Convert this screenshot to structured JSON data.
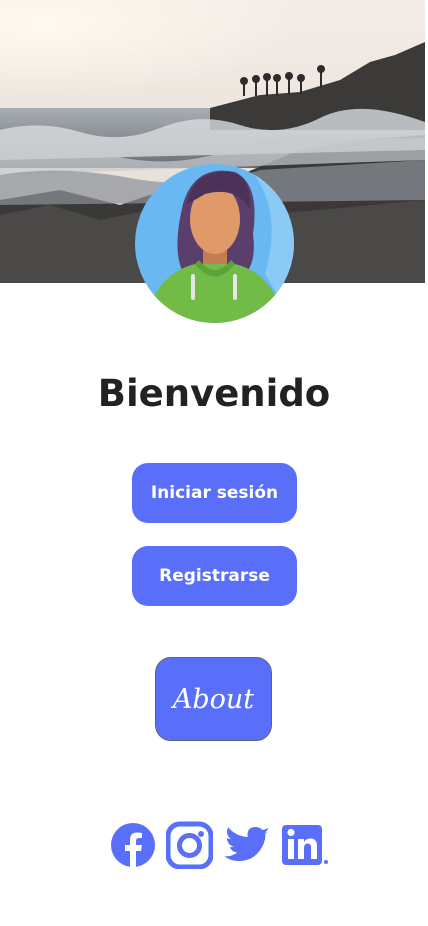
{
  "header": {
    "image": "beach-sunset-photo"
  },
  "profile": {
    "avatar": "woman-avatar-icon"
  },
  "welcome": {
    "title": "Bienvenido"
  },
  "actions": {
    "login_label": "Iniciar sesión",
    "register_label": "Registrarse",
    "about_label": "About"
  },
  "social": {
    "items": [
      "facebook-icon",
      "instagram-icon",
      "twitter-icon",
      "linkedin-icon"
    ],
    "color": "#5a6ff9"
  },
  "colors": {
    "accent": "#5a6ff9",
    "title": "#222222"
  }
}
